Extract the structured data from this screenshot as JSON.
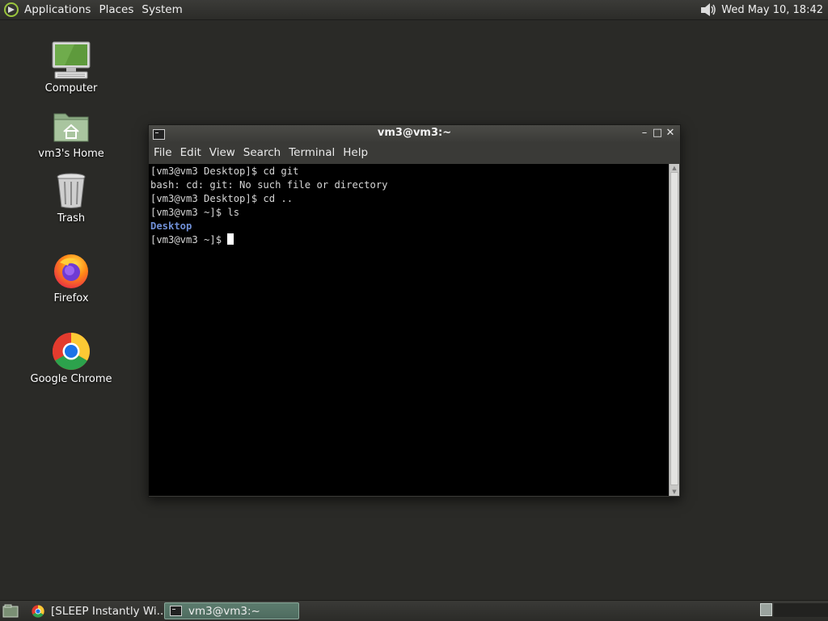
{
  "top_panel": {
    "menus": [
      "Applications",
      "Places",
      "System"
    ],
    "clock": "Wed May 10, 18:42"
  },
  "desktop": {
    "icons": [
      {
        "label": "Computer",
        "icon": "computer-icon"
      },
      {
        "label": "vm3's Home",
        "icon": "home-folder-icon"
      },
      {
        "label": "Trash",
        "icon": "trash-icon"
      },
      {
        "label": "Firefox",
        "icon": "firefox-icon"
      },
      {
        "label": "Google Chrome",
        "icon": "chrome-icon"
      }
    ]
  },
  "terminal_window": {
    "title": "vm3@vm3:~",
    "menu": [
      "File",
      "Edit",
      "View",
      "Search",
      "Terminal",
      "Help"
    ],
    "lines": [
      "[vm3@vm3 Desktop]$ cd git",
      "bash: cd: git: No such file or directory",
      "[vm3@vm3 Desktop]$ cd ..",
      "[vm3@vm3 ~]$ ls",
      "Desktop",
      "[vm3@vm3 ~]$ "
    ]
  },
  "taskbar": {
    "tasks": [
      {
        "label": "[SLEEP Instantly Wi...",
        "icon": "chrome-icon",
        "active": false
      },
      {
        "label": "vm3@vm3:~",
        "icon": "terminal-icon",
        "active": true
      }
    ]
  },
  "colors": {
    "desktop_bg": "#2a2a27",
    "terminal_bg": "#000000",
    "directory_text": "#6f8fd6",
    "active_task": "#5c7c6e"
  }
}
